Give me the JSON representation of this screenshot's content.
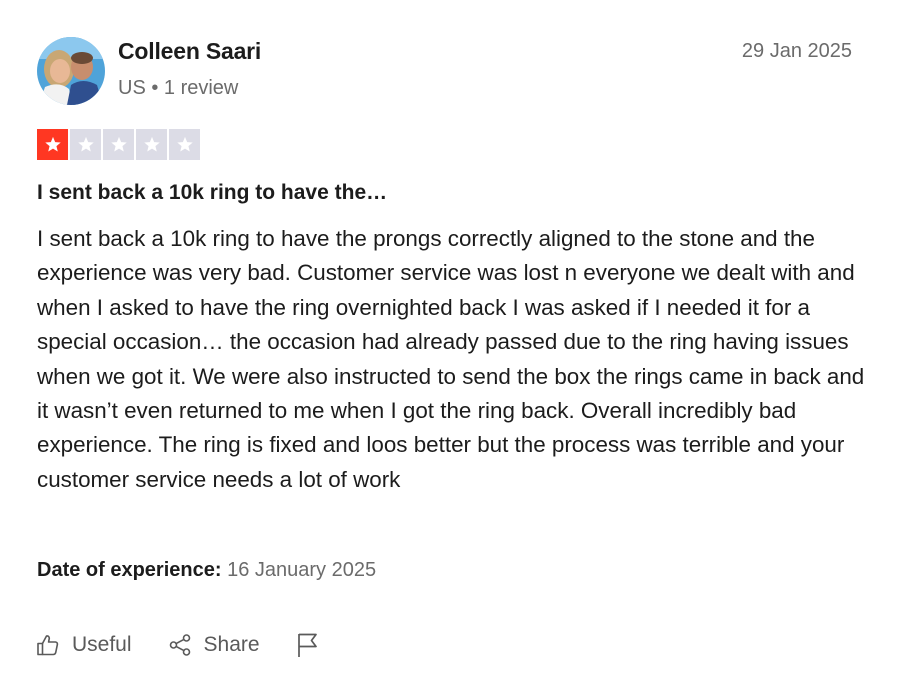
{
  "reviewer": {
    "name": "Colleen Saari",
    "meta": "US • 1 review",
    "avatar_icon": "profile-photo"
  },
  "review": {
    "date": "29 Jan 2025",
    "rating": 1,
    "rating_max": 5,
    "title": "I sent back a 10k ring to have the…",
    "body": "I sent back a 10k ring to have the prongs correctly aligned to the stone and the experience was very bad. Customer service was lost n everyone we dealt with and when I asked to have the ring overnighted back I was asked if I needed it for a special occasion… the occasion had already passed due to the ring having issues when we got it. We were also instructed to send the box the rings came in back and it wasn’t even returned to me when I got the ring back. Overall incredibly bad experience. The ring is fixed and loos better but the process was terrible and your customer service needs a lot of work",
    "experience_label": "Date of experience:",
    "experience_date": "16 January 2025"
  },
  "actions": {
    "useful_label": "Useful",
    "share_label": "Share",
    "useful_icon": "thumbs-up-icon",
    "share_icon": "share-icon",
    "flag_icon": "flag-icon"
  },
  "colors": {
    "star_filled": "#ff3722",
    "star_empty": "#dcdce6",
    "text_primary": "#1c1c1c",
    "text_secondary": "#6b6b6b"
  }
}
